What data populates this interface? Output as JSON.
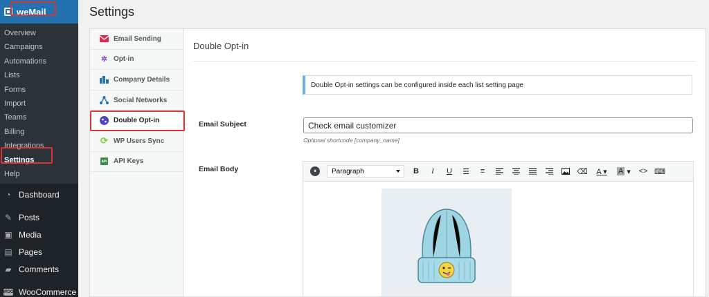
{
  "sidebar": {
    "plugin_name": "weMail",
    "submenu": [
      "Overview",
      "Campaigns",
      "Automations",
      "Lists",
      "Forms",
      "Import",
      "Teams",
      "Billing",
      "Integrations",
      "Settings",
      "Help"
    ],
    "main": [
      {
        "label": "Dashboard",
        "icon": "dashboard-icon"
      },
      {
        "label": "Posts",
        "icon": "pin-icon"
      },
      {
        "label": "Media",
        "icon": "media-icon"
      },
      {
        "label": "Pages",
        "icon": "pages-icon"
      },
      {
        "label": "Comments",
        "icon": "comments-icon"
      },
      {
        "label": "WooCommerce",
        "icon": "woocommerce-icon"
      }
    ]
  },
  "page": {
    "title": "Settings"
  },
  "tabs": [
    "Email Sending",
    "Opt-in",
    "Company Details",
    "Social Networks",
    "Double Opt-in",
    "WP Users Sync",
    "API Keys"
  ],
  "content": {
    "section_title": "Double Opt-in",
    "notice": "Double Opt-in settings can be configured inside each list setting page",
    "subject_label": "Email Subject",
    "subject_value": "Check email customizer",
    "subject_hint": "Optional shortcode [company_name]",
    "body_label": "Email Body",
    "format_select": "Paragraph"
  },
  "colors": {
    "accent": "#2271b1",
    "highlight": "#d63638",
    "notice_border": "#72aee6"
  }
}
